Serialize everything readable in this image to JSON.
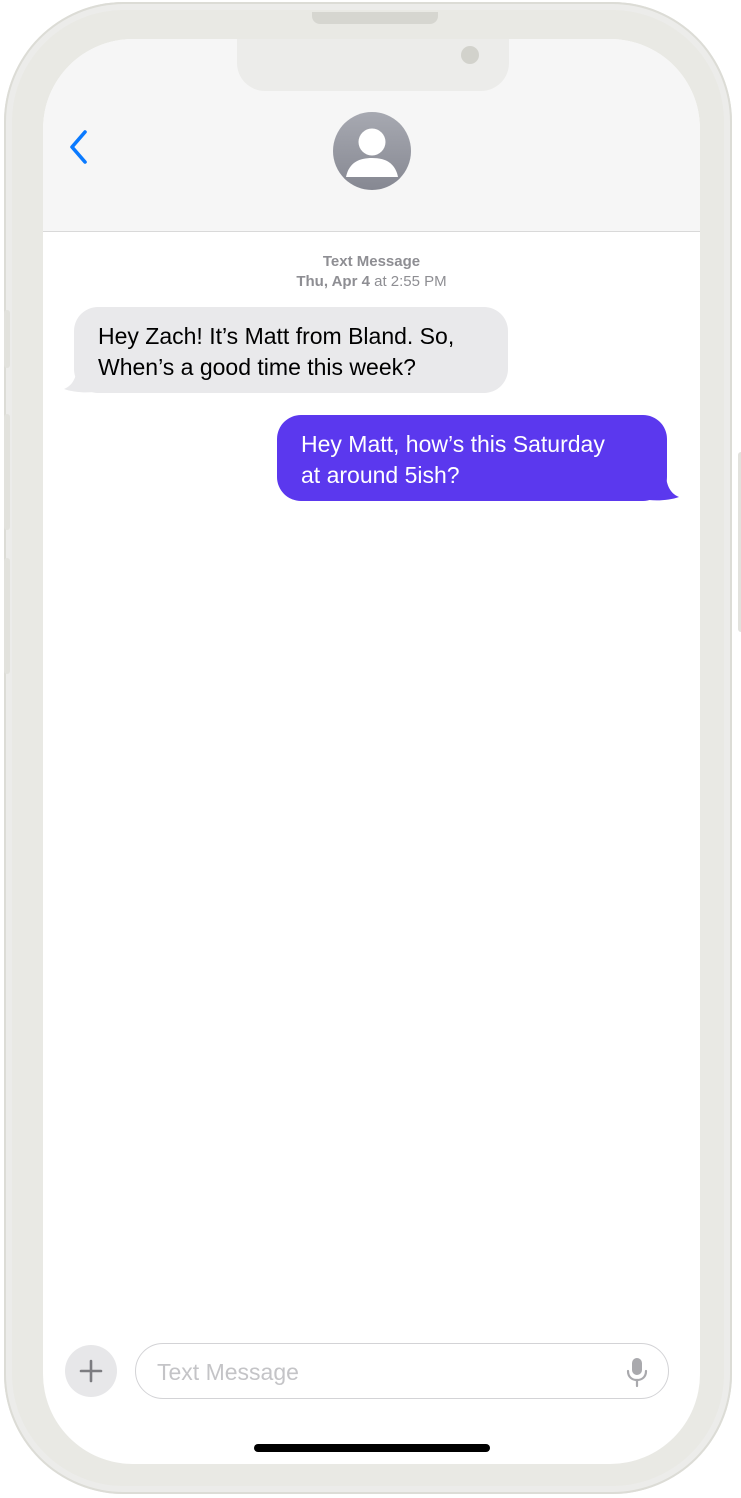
{
  "header": {
    "back_icon": "chevron-left-icon",
    "avatar_icon": "person-silhouette-icon",
    "accent_color": "#0a7aff"
  },
  "conversation": {
    "service": "Text Message",
    "date": "Thu, Apr 4",
    "at": "at",
    "time": "2:55 PM",
    "messages": [
      {
        "direction": "incoming",
        "text": "Hey Zach! It’s Matt from Bland. So,\nWhen’s a good time this week?",
        "bubble_color": "#e9e9eb"
      },
      {
        "direction": "outgoing",
        "text": "Hey Matt, how’s this Saturday\nat around 5ish?",
        "bubble_color": "#5b38ee"
      }
    ]
  },
  "composer": {
    "plus_icon": "plus-icon",
    "placeholder": "Text Message",
    "value": "",
    "mic_icon": "microphone-icon"
  }
}
